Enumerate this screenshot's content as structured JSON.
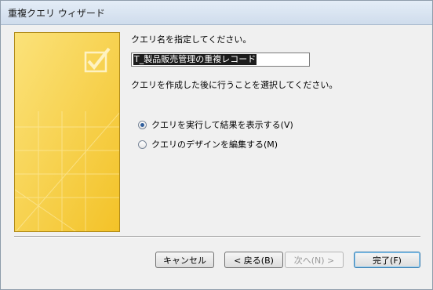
{
  "window": {
    "title": "重複クエリ ウィザード"
  },
  "form": {
    "name_prompt": "クエリ名を指定してください。",
    "query_name": "T_製品販売管理の重複レコード",
    "next_prompt": "クエリを作成した後に行うことを選択してください。",
    "options": [
      {
        "label": "クエリを実行して結果を表示する(V)",
        "checked": true
      },
      {
        "label": "クエリのデザインを編集する(M)",
        "checked": false
      }
    ]
  },
  "buttons": {
    "cancel": "キャンセル",
    "back": "< 戻る(B)",
    "next": "次へ(N) >",
    "finish": "完了(F)"
  }
}
